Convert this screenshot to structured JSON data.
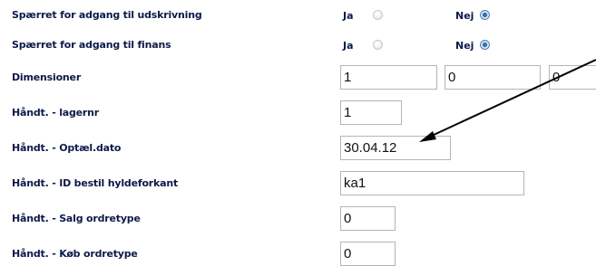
{
  "rows": [
    {
      "label": "Spærret for adgang til udskrivning"
    },
    {
      "label": "Spærret for adgang til finans"
    },
    {
      "label": "Dimensioner"
    },
    {
      "label": "Håndt. - lagernr"
    },
    {
      "label": "Håndt. - Optæl.dato"
    },
    {
      "label": "Håndt. - ID bestil hyldeforkant"
    },
    {
      "label": "Håndt. - Salg ordretype"
    },
    {
      "label": "Håndt. - Køb ordretype"
    }
  ],
  "radio_yes_label": "Ja",
  "radio_no_label": "Nej",
  "spaerret_udskrivning": {
    "selected": "Nej"
  },
  "spaerret_finans": {
    "selected": "Nej"
  },
  "fields": {
    "dim1": "1",
    "dim2": "0",
    "dim3": "0",
    "lagernr": "1",
    "optael_dato": "30.04.12",
    "id_bestil": "ka1",
    "salg_ordretype": "0",
    "koeb_ordretype": "0"
  },
  "colors": {
    "label": "#0d1a4a",
    "radio_selected": "#2e6fb4",
    "annotation_arrow": "#000000"
  }
}
